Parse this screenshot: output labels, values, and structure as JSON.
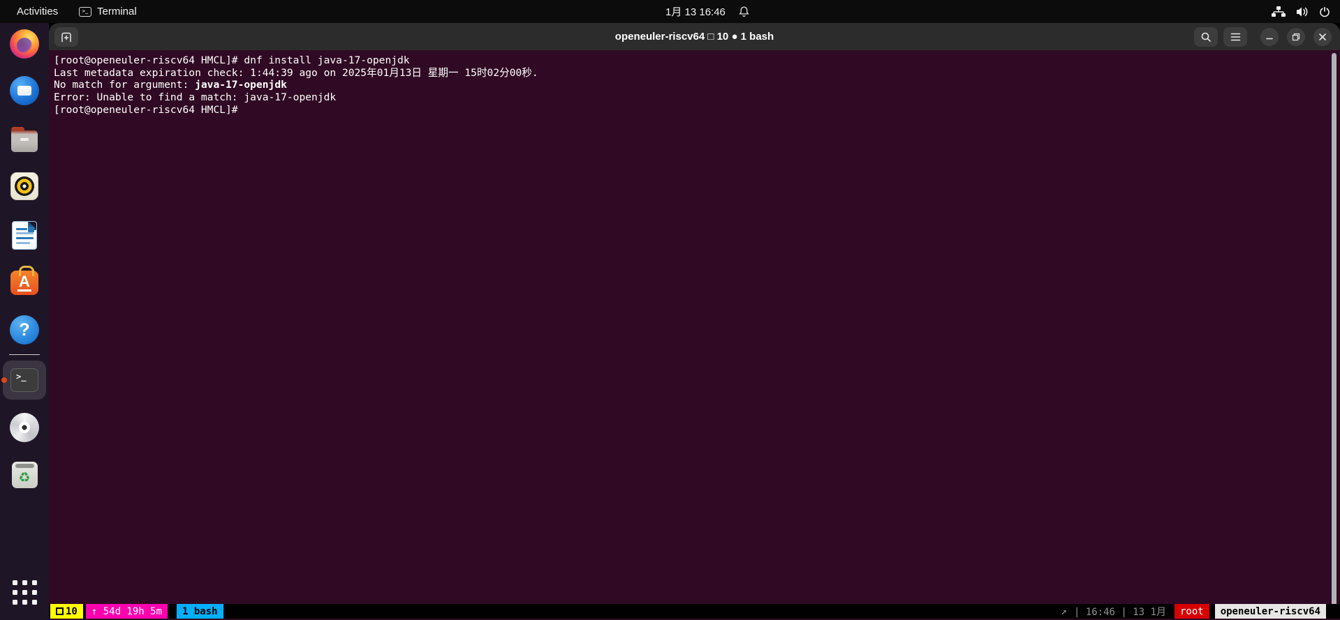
{
  "top_bar": {
    "activities_label": "Activities",
    "focused_app_label": "Terminal",
    "clock": "1月 13 16:46",
    "system_icons": [
      "network-icon",
      "volume-icon",
      "power-icon"
    ]
  },
  "window": {
    "title": "openeuler-riscv64 □ 10 ● 1 bash"
  },
  "terminal": {
    "bg_color": "#300a24",
    "lines": [
      {
        "segments": [
          {
            "t": "[root@openeuler-riscv64 HMCL]# dnf install java-17-openjdk",
            "b": false
          }
        ]
      },
      {
        "segments": [
          {
            "t": "Last metadata expiration check: 1:44:39 ago on 2025年01月13日 星期一 15时02分00秒.",
            "b": false
          }
        ]
      },
      {
        "segments": [
          {
            "t": "No match for argument: ",
            "b": false
          },
          {
            "t": "java-17-openjdk",
            "b": true
          }
        ]
      },
      {
        "segments": [
          {
            "t": "Error: Unable to find a match: java-17-openjdk",
            "b": false
          }
        ]
      },
      {
        "segments": [
          {
            "t": "[root@openeuler-riscv64 HMCL]# ",
            "b": false
          }
        ]
      }
    ]
  },
  "dock": {
    "items": [
      "firefox",
      "thunderbird",
      "files",
      "rhythmbox",
      "libreoffice-writer",
      "app-center",
      "help",
      "terminal",
      "disc",
      "trash"
    ],
    "show_apps": "show-applications"
  },
  "status_bar": {
    "windows_count": "10",
    "uptime": "↑ 54d 19h 5m",
    "active_window": "1 bash",
    "right_text": "| 16:46 | 13 1月",
    "user": "root",
    "host": "openeuler-riscv64",
    "colors": {
      "windows_bg": "#ffff00",
      "uptime_bg": "#ff00af",
      "window_bg": "#00afff",
      "user_bg": "#d70000",
      "host_bg": "#e6e6e4",
      "terminal_bg": "#300a24"
    }
  },
  "glyphs": {
    "terminal_prompt": ">_",
    "help_question": "?",
    "app_center_letter": "A",
    "recycle": "♻",
    "ne_arrow": "↗"
  }
}
